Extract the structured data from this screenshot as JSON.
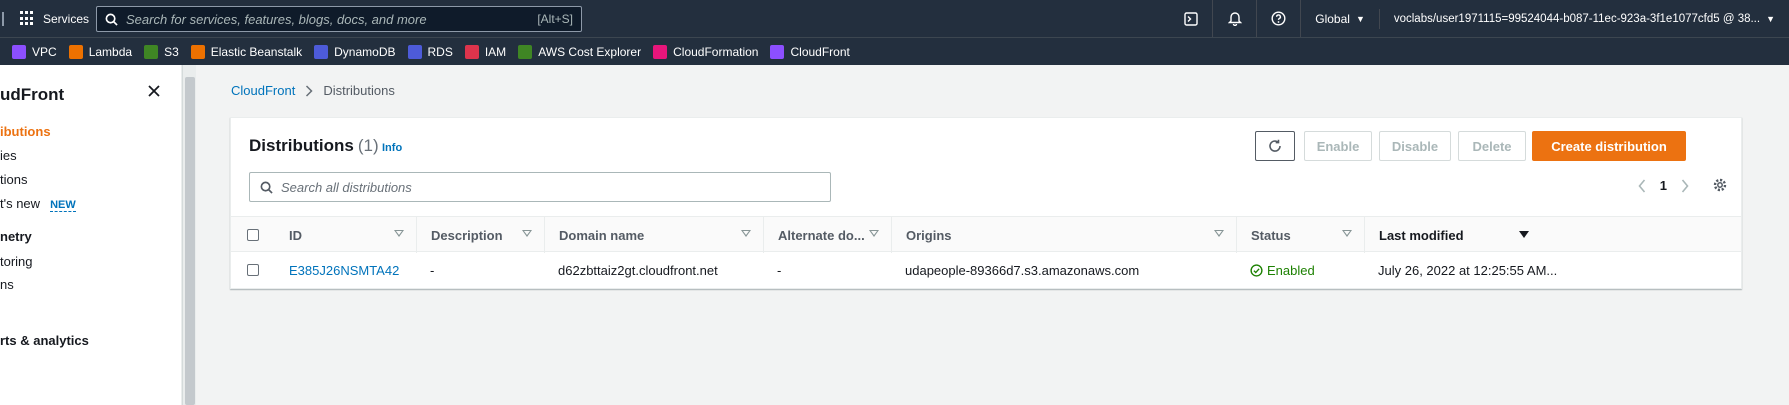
{
  "topnav": {
    "services_label": "Services",
    "search_placeholder": "Search for services, features, blogs, docs, and more",
    "search_shortcut": "[Alt+S]",
    "region": "Global",
    "account": "voclabs/user1971115=99524044-b087-11ec-923a-3f1e1077cfd5 @ 38..."
  },
  "favorites": [
    {
      "label": "VPC",
      "color": "#8c4fff"
    },
    {
      "label": "Lambda",
      "color": "#ed7100"
    },
    {
      "label": "S3",
      "color": "#3f8624"
    },
    {
      "label": "Elastic Beanstalk",
      "color": "#ed7100"
    },
    {
      "label": "DynamoDB",
      "color": "#4d5bd9"
    },
    {
      "label": "RDS",
      "color": "#4d5bd9"
    },
    {
      "label": "IAM",
      "color": "#dd344c"
    },
    {
      "label": "AWS Cost Explorer",
      "color": "#3f8624"
    },
    {
      "label": "CloudFormation",
      "color": "#e7157b"
    },
    {
      "label": "CloudFront",
      "color": "#8c4fff"
    }
  ],
  "sidebar": {
    "title": "udFront",
    "items": [
      {
        "label": "ibutions"
      },
      {
        "label": "ies"
      },
      {
        "label": "tions"
      },
      {
        "label": "t's new",
        "badge": "NEW"
      }
    ],
    "section1": "netry",
    "section1_items": [
      {
        "label": "toring"
      },
      {
        "label": "ns"
      }
    ],
    "section2": "rts & analytics"
  },
  "breadcrumb": {
    "root": "CloudFront",
    "current": "Distributions"
  },
  "panel": {
    "title": "Distributions",
    "count": "(1)",
    "info": "Info",
    "buttons": {
      "enable": "Enable",
      "disable": "Disable",
      "delete": "Delete",
      "create": "Create distribution"
    },
    "search_placeholder": "Search all distributions",
    "page": "1"
  },
  "table": {
    "columns": [
      "ID",
      "Description",
      "Domain name",
      "Alternate do...",
      "Origins",
      "Status",
      "Last modified"
    ],
    "rows": [
      {
        "id": "E385J26NSMTA42",
        "description": "-",
        "domain": "d62zbttaiz2gt.cloudfront.net",
        "alternate": "-",
        "origins": "udapeople-89366d7.s3.amazonaws.com",
        "status": "Enabled",
        "last_modified": "July 26, 2022 at 12:25:55 AM..."
      }
    ]
  },
  "colors": {
    "nav": "#232f3e",
    "accent": "#ec7211",
    "link": "#0073bb",
    "success": "#1d8102"
  }
}
